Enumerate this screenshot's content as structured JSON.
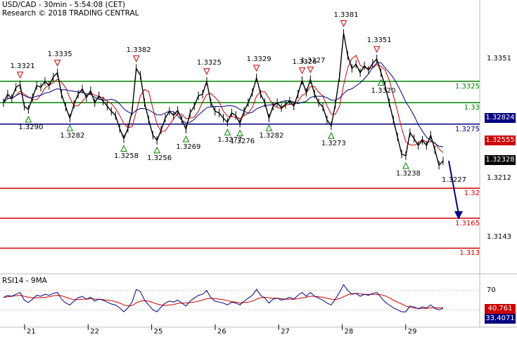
{
  "header": {
    "title": "USD/CAD - 30min - 5:54:08 (CET)",
    "subtitle": "Research © 2018 TRADING CENTRAL"
  },
  "colors": {
    "support_line": "#000080",
    "resistance_lines": "#008000",
    "target_lines": "#cc0000",
    "price_tag_current": "#000000",
    "price_tag_support": "#000080",
    "price_tag_red": "#cc0000",
    "rsi_tag_blue": "#000080",
    "rsi_tag_red": "#cc0000",
    "arrow": "#000080",
    "ma_fast": "#cc0000",
    "ma_slow": "#000080"
  },
  "chart_data": [
    {
      "type": "line",
      "title": "USD/CAD - 30min",
      "x_tick_labels": [
        "21",
        "22",
        "25",
        "26",
        "27",
        "28",
        "29"
      ],
      "y_tick_labels": [
        "1.3351",
        "1.3212",
        "1.3143"
      ],
      "ylim": [
        1.31,
        1.342
      ],
      "price_series": [
        1.33,
        1.331,
        1.3305,
        1.3318,
        1.3321,
        1.3296,
        1.3292,
        1.3306,
        1.332,
        1.3318,
        1.3325,
        1.332,
        1.333,
        1.3335,
        1.331,
        1.3295,
        1.3282,
        1.3298,
        1.331,
        1.3316,
        1.3306,
        1.3314,
        1.33,
        1.3308,
        1.3302,
        1.3296,
        1.329,
        1.3285,
        1.327,
        1.3258,
        1.327,
        1.329,
        1.334,
        1.3332,
        1.33,
        1.328,
        1.3262,
        1.3256,
        1.3268,
        1.3282,
        1.329,
        1.3285,
        1.3291,
        1.328,
        1.3269,
        1.3288,
        1.3296,
        1.3308,
        1.331,
        1.3325,
        1.33,
        1.329,
        1.3288,
        1.3282,
        1.3277,
        1.3288,
        1.3285,
        1.3276,
        1.329,
        1.33,
        1.3312,
        1.3329,
        1.331,
        1.33,
        1.3282,
        1.3296,
        1.33,
        1.3294,
        1.3298,
        1.3302,
        1.3296,
        1.331,
        1.3326,
        1.3312,
        1.3327,
        1.331,
        1.33,
        1.3295,
        1.328,
        1.3273,
        1.3298,
        1.333,
        1.3381,
        1.3355,
        1.334,
        1.3345,
        1.3335,
        1.3343,
        1.3338,
        1.3346,
        1.3351,
        1.3335,
        1.332,
        1.33,
        1.328,
        1.326,
        1.324,
        1.3238,
        1.3265,
        1.3258,
        1.325,
        1.3256,
        1.325,
        1.3262,
        1.3245,
        1.3227,
        1.3232
      ],
      "annotations": {
        "highs": [
          {
            "label": "1.3321",
            "i": 4
          },
          {
            "label": "1.3335",
            "i": 13
          },
          {
            "label": "1.3382",
            "i": 32
          },
          {
            "label": "1.3325",
            "i": 49
          },
          {
            "label": "1.3329",
            "i": 61
          },
          {
            "label": "1.3326",
            "i": 72
          },
          {
            "label": "1.3327",
            "i": 74
          },
          {
            "label": "1.3381",
            "i": 82
          },
          {
            "label": "1.3351",
            "i": 90
          }
        ],
        "lows": [
          {
            "label": "1.3290",
            "i": 6
          },
          {
            "label": "1.3282",
            "i": 16
          },
          {
            "label": "1.3258",
            "i": 29
          },
          {
            "label": "1.3256",
            "i": 37
          },
          {
            "label": "1.3269",
            "i": 44
          },
          {
            "label": "1.3277",
            "i": 54
          },
          {
            "label": "1.3276",
            "i": 57
          },
          {
            "label": "1.3282",
            "i": 64
          },
          {
            "label": "1.3273",
            "i": 79
          },
          {
            "label": "1.3320",
            "i": 91
          },
          {
            "label": "1.3238",
            "i": 97
          }
        ],
        "last_label": "1.3227"
      },
      "levels": [
        {
          "value": 1.3325,
          "label": "1.3325",
          "role": "resistance"
        },
        {
          "value": 1.33,
          "label": "1.33",
          "role": "resistance"
        },
        {
          "value": 1.3275,
          "label": "1.3275",
          "role": "pivot"
        },
        {
          "value": 1.32,
          "label": "1.32",
          "role": "target"
        },
        {
          "value": 1.3165,
          "label": "1.3165",
          "role": "target"
        },
        {
          "value": 1.313,
          "label": "1.313",
          "role": "target"
        }
      ],
      "price_tags": [
        {
          "label": "1.32824",
          "value": 1.32824,
          "role": "support"
        },
        {
          "label": "1.32555",
          "value": 1.32555,
          "role": "red"
        },
        {
          "label": "1.32328",
          "value": 1.32328,
          "role": "current"
        }
      ],
      "forecast_arrow": {
        "from": 1.3232,
        "to": 1.3165
      }
    },
    {
      "type": "line",
      "title": "RSI14 - 9MA",
      "ylim": [
        0,
        100
      ],
      "y_tick_labels": [
        "70",
        "30"
      ],
      "series": [
        {
          "name": "RSI14",
          "values": [
            55,
            60,
            58,
            62,
            66,
            50,
            45,
            52,
            60,
            58,
            62,
            60,
            64,
            66,
            52,
            44,
            40,
            48,
            55,
            58,
            52,
            56,
            48,
            52,
            50,
            46,
            42,
            40,
            34,
            26,
            34,
            46,
            72,
            68,
            50,
            40,
            30,
            26,
            36,
            44,
            48,
            46,
            50,
            44,
            38,
            48,
            54,
            60,
            62,
            70,
            55,
            48,
            46,
            44,
            40,
            46,
            44,
            40,
            48,
            54,
            60,
            72,
            60,
            54,
            44,
            52,
            54,
            50,
            52,
            56,
            52,
            60,
            66,
            58,
            66,
            58,
            54,
            50,
            44,
            40,
            52,
            66,
            82,
            70,
            62,
            64,
            58,
            62,
            60,
            64,
            66,
            56,
            46,
            40,
            34,
            30,
            26,
            26,
            38,
            36,
            32,
            36,
            34,
            40,
            33,
            30,
            33
          ]
        },
        {
          "name": "9MA",
          "values": [
            56,
            57,
            58,
            59,
            60,
            58,
            56,
            55,
            55,
            55,
            56,
            57,
            59,
            60,
            59,
            56,
            53,
            51,
            51,
            52,
            52,
            53,
            52,
            52,
            51,
            50,
            49,
            47,
            44,
            40,
            38,
            39,
            44,
            48,
            49,
            48,
            45,
            42,
            40,
            39,
            40,
            41,
            43,
            44,
            44,
            45,
            46,
            48,
            50,
            53,
            54,
            53,
            52,
            51,
            49,
            47,
            46,
            44,
            45,
            46,
            48,
            52,
            55,
            56,
            55,
            54,
            54,
            53,
            52,
            52,
            52,
            53,
            55,
            56,
            58,
            58,
            57,
            56,
            54,
            52,
            51,
            53,
            57,
            61,
            63,
            64,
            63,
            62,
            62,
            62,
            62,
            61,
            59,
            55,
            50,
            46,
            42,
            38,
            35,
            34,
            33,
            33,
            33,
            34,
            34,
            34,
            34
          ]
        }
      ],
      "last_values": [
        {
          "label": "40.761",
          "role": "red"
        },
        {
          "label": "33.4071",
          "role": "blue"
        }
      ]
    }
  ]
}
